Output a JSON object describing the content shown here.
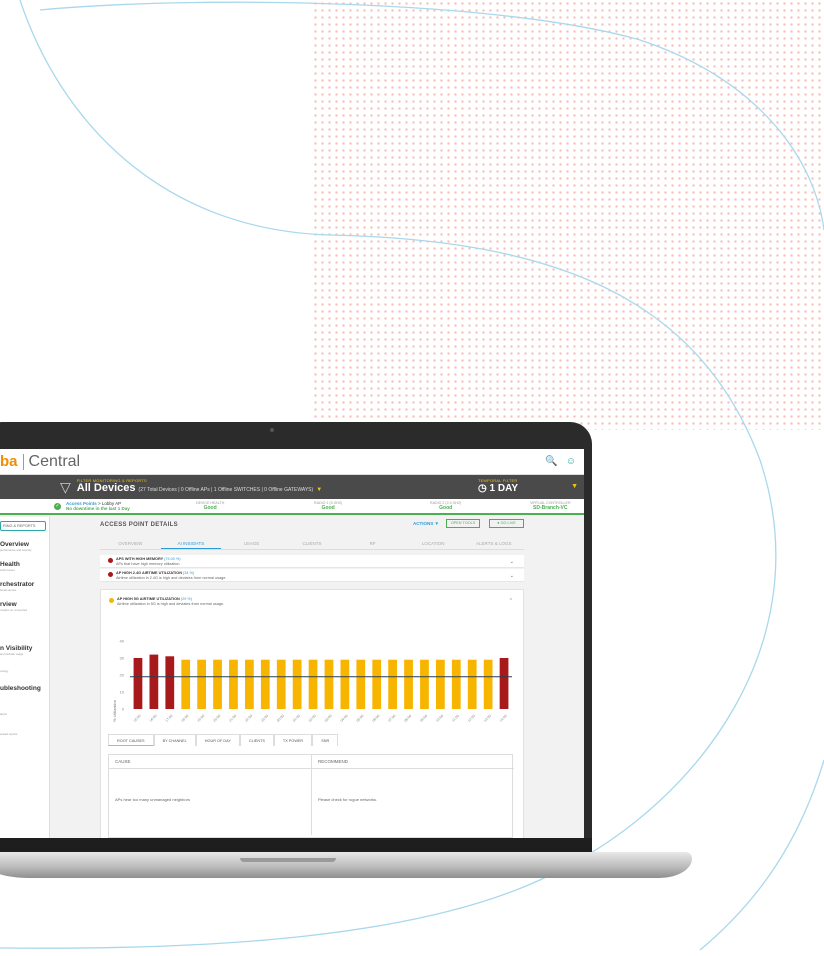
{
  "app": {
    "brand_prefix": "ba",
    "brand_name": "Central"
  },
  "filter": {
    "label": "FILTER MONITORING & REPORTS",
    "title": "All Devices",
    "subtitle": "(27 Total Devices | 0 Offline APs | 1 Offline SWITCHES | 0 Offline GATEWAYS)"
  },
  "temporal": {
    "label": "TEMPORAL FILTER",
    "value": "1 DAY"
  },
  "status": {
    "ap_link": "Access Points",
    "ap_name": "> Lobby AP",
    "ap_msg": "No downtime in the last 1 Day",
    "items": [
      {
        "k": "DEVICE HEALTH",
        "v": "Good"
      },
      {
        "k": "RADIO 1 (5 GHz)",
        "v": "Good"
      },
      {
        "k": "RADIO 2 (2.4 GHz)",
        "v": "Good"
      },
      {
        "k": "VIRTUAL CONTROLLER",
        "v": "SD-Branch-VC"
      }
    ]
  },
  "sidebar": {
    "filter": "RING & REPORTS",
    "items": [
      {
        "t": "Overview",
        "s": "performance and security"
      },
      {
        "t": "Health",
        "s": "work issues"
      },
      {
        "t": "rchestrator",
        "s": "tional service"
      },
      {
        "t": "rview",
        "s": "rmation on connected"
      },
      {
        "t": "n Visibility",
        "s": "and website usage"
      },
      {
        "t": "ubleshooting",
        "s": ""
      }
    ],
    "small": [
      "nology",
      "alerts",
      "erated reports"
    ]
  },
  "page": {
    "title": "ACCESS POINT DETAILS",
    "actions": "ACTIONS",
    "open_tools": "OPEN TOOLS",
    "go_live": "GO LIVE",
    "tabs": [
      "OVERVIEW",
      "AI INSIGHTS",
      "USAGE",
      "CLIENTS",
      "RF",
      "LOCATION",
      "ALERTS & LOGS"
    ]
  },
  "alerts": [
    {
      "title": "APS WITH HIGH MEMORY",
      "pct": "(75.00 %)",
      "sub": "APs that have high memory utilization",
      "color": "#a8191b"
    },
    {
      "title": "AP HIGH 2.4G AIRTIME UTILIZATION",
      "pct": "(34 %)",
      "sub": "Airtime utilization in 2.4G is high and deviates from normal usage.",
      "color": "#a8191b"
    },
    {
      "title": "AP HIGH 5G AIRTIME UTILIZATION",
      "pct": "(29 %)",
      "sub": "Airtime utilization in 5G is high and deviates from normal usage.",
      "color": "#f7b500"
    }
  ],
  "chart_data": {
    "type": "bar",
    "ylabel": "% Utilization",
    "yticks": [
      0,
      10,
      20,
      30,
      40
    ],
    "ylim": [
      0,
      40
    ],
    "baseline": 19,
    "categories": [
      "15:00",
      "16:00",
      "17:00",
      "18:00",
      "19:00",
      "20:00",
      "21:00",
      "22:00",
      "23:00",
      "00:00",
      "01:00",
      "02:00",
      "03:00",
      "04:00",
      "05:00",
      "06:00",
      "07:00",
      "08:00",
      "09:00",
      "10:00",
      "11:00",
      "12:00",
      "13:00",
      "14:00"
    ],
    "values": [
      30,
      32,
      31,
      29,
      29,
      29,
      29,
      29,
      29,
      29,
      29,
      29,
      29,
      29,
      29,
      29,
      29,
      29,
      29,
      29,
      29,
      29,
      29,
      30
    ],
    "colors": [
      "#a8191b",
      "#a8191b",
      "#a8191b",
      "#f7b500",
      "#f7b500",
      "#f7b500",
      "#f7b500",
      "#f7b500",
      "#f7b500",
      "#f7b500",
      "#f7b500",
      "#f7b500",
      "#f7b500",
      "#f7b500",
      "#f7b500",
      "#f7b500",
      "#f7b500",
      "#f7b500",
      "#f7b500",
      "#f7b500",
      "#f7b500",
      "#f7b500",
      "#f7b500",
      "#a8191b"
    ]
  },
  "subtabs": [
    "ROOT CAUSES",
    "BY CHANNEL",
    "HOUR OF DAY",
    "CLIENTS",
    "TX POWER",
    "SNR"
  ],
  "table": {
    "headers": [
      "CAUSE",
      "RECOMMEND"
    ],
    "cause": "APs hear too many unmanaged neighbors",
    "recommend": "Please check for rogue networks."
  }
}
